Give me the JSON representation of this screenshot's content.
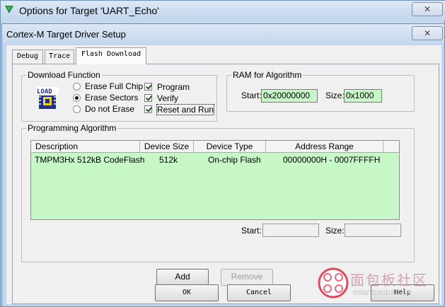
{
  "outer_window": {
    "title": "Options for Target 'UART_Echo'",
    "close": "✕"
  },
  "dialog": {
    "title": "Cortex-M Target Driver Setup",
    "close": "✕"
  },
  "tabs": [
    {
      "label": "Debug",
      "active": false
    },
    {
      "label": "Trace",
      "active": false
    },
    {
      "label": "Flash Download",
      "active": true
    }
  ],
  "download_function": {
    "label": "Download Function",
    "icon": "load-icon",
    "erase_options": [
      {
        "label": "Erase Full Chip",
        "checked": false
      },
      {
        "label": "Erase Sectors",
        "checked": true
      },
      {
        "label": "Do not Erase",
        "checked": false
      }
    ],
    "actions": [
      {
        "label": "Program",
        "checked": true
      },
      {
        "label": "Verify",
        "checked": true
      },
      {
        "label": "Reset and Run",
        "checked": true
      }
    ]
  },
  "ram_for_algorithm": {
    "label": "RAM for Algorithm",
    "start_label": "Start:",
    "start_value": "0x20000000",
    "size_label": "Size:",
    "size_value": "0x1000"
  },
  "programming_algorithm": {
    "label": "Programming Algorithm",
    "columns": [
      "Description",
      "Device Size",
      "Device Type",
      "Address Range"
    ],
    "rows": [
      [
        "TMPM3Hx 512kB CodeFlash",
        "512k",
        "On-chip Flash",
        "00000000H - 0007FFFFH"
      ]
    ],
    "start_label": "Start:",
    "start_value": "",
    "size_label": "Size:",
    "size_value": ""
  },
  "buttons": {
    "add": "Add",
    "remove": "Remove",
    "ok": "OK",
    "cancel": "Cancel",
    "help": "Help"
  },
  "watermark": {
    "text": "面包板社区",
    "url": "mianbaoban.cn"
  },
  "colors": {
    "field_bg": "#c7f7c7",
    "title_bar": "#c5d8ee",
    "panel_bg": "#f0f0f0"
  }
}
